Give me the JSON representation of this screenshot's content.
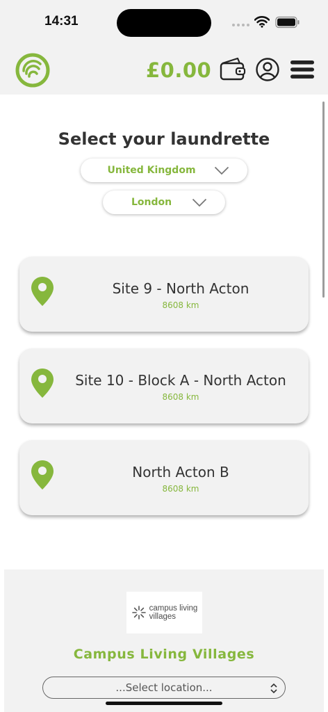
{
  "status_bar": {
    "time": "14:31"
  },
  "header": {
    "balance": "£0.00",
    "icons": [
      "app-logo-icon",
      "wallet-icon",
      "user-account-icon",
      "menu-icon"
    ]
  },
  "main": {
    "title": "Select your laundrette",
    "country_select": {
      "value": "United Kingdom"
    },
    "city_select": {
      "value": "London"
    },
    "sites": [
      {
        "name": "Site 9 - North Acton",
        "distance": "8608 km"
      },
      {
        "name": "Site 10 - Block A - North Acton",
        "distance": "8608 km"
      },
      {
        "name": "North Acton B",
        "distance": "8608 km"
      }
    ]
  },
  "provider": {
    "logo_line1": "campus living",
    "logo_line2": "villages",
    "name": "Campus Living Villages",
    "location_placeholder": "...Select location..."
  },
  "colors": {
    "accent": "#86b73d",
    "card_bg": "#f2f2f2",
    "text": "#333333"
  }
}
